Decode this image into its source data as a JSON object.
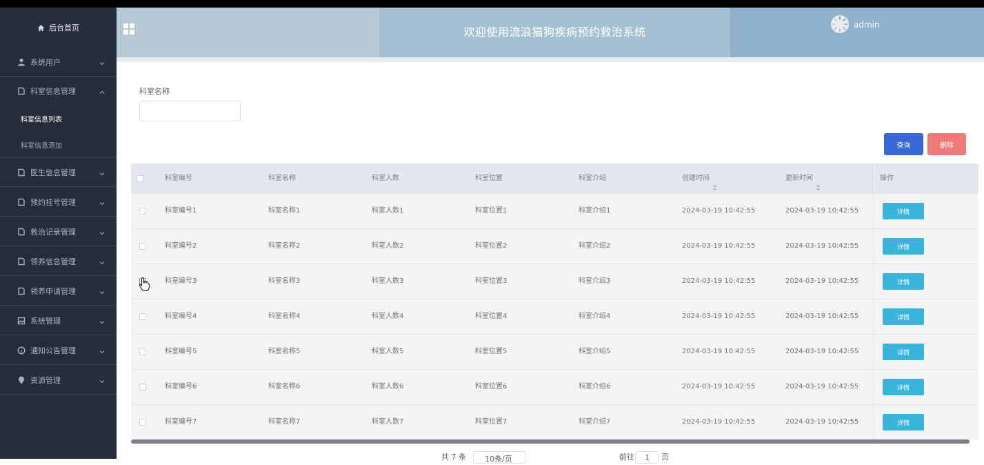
{
  "sidebar": {
    "home": "后台首页",
    "menu": [
      {
        "label": "系统用户",
        "icon": "user-icon",
        "expanded": false
      },
      {
        "label": "科室信息管理",
        "icon": "document-icon",
        "expanded": true,
        "children": [
          {
            "label": "科室信息列表",
            "active": true
          },
          {
            "label": "科室信息添加",
            "active": false
          }
        ]
      },
      {
        "label": "医生信息管理",
        "icon": "document-icon",
        "expanded": false
      },
      {
        "label": "预约挂号管理",
        "icon": "document-icon",
        "expanded": false
      },
      {
        "label": "救治记录管理",
        "icon": "document-icon",
        "expanded": false
      },
      {
        "label": "领养信息管理",
        "icon": "document-icon",
        "expanded": false
      },
      {
        "label": "领养申请管理",
        "icon": "document-icon",
        "expanded": false
      },
      {
        "label": "系统管理",
        "icon": "picture-icon",
        "expanded": false
      },
      {
        "label": "通知公告管理",
        "icon": "info-icon",
        "expanded": false
      },
      {
        "label": "资源管理",
        "icon": "location-icon",
        "expanded": false
      }
    ]
  },
  "header": {
    "title": "欢迎使用流浪猫狗疾病预约救治系统",
    "username": "admin",
    "colors": {
      "left": "#b7c9d6",
      "center": "#a6c0d3",
      "right": "#8fb1cb"
    }
  },
  "search": {
    "label": "科室名称",
    "value": "",
    "placeholder": ""
  },
  "actions": {
    "query": "查询",
    "delete": "删除"
  },
  "table": {
    "columns": [
      "科室编号",
      "科室名称",
      "科室人数",
      "科室位置",
      "科室介绍",
      "创建时间",
      "更新时间",
      "操作"
    ],
    "rows": [
      {
        "code": "科室编号1",
        "name": "科室名称1",
        "count": "科室人数1",
        "location": "科室位置1",
        "intro": "科室介绍1",
        "created": "2024-03-19 10:42:55",
        "updated": "2024-03-19 10:42:55",
        "action": "详情"
      },
      {
        "code": "科室编号2",
        "name": "科室名称2",
        "count": "科室人数2",
        "location": "科室位置2",
        "intro": "科室介绍2",
        "created": "2024-03-19 10:42:55",
        "updated": "2024-03-19 10:42:55",
        "action": "详情"
      },
      {
        "code": "科室编号3",
        "name": "科室名称3",
        "count": "科室人数3",
        "location": "科室位置3",
        "intro": "科室介绍3",
        "created": "2024-03-19 10:42:55",
        "updated": "2024-03-19 10:42:55",
        "action": "详情"
      },
      {
        "code": "科室编号4",
        "name": "科室名称4",
        "count": "科室人数4",
        "location": "科室位置4",
        "intro": "科室介绍4",
        "created": "2024-03-19 10:42:55",
        "updated": "2024-03-19 10:42:55",
        "action": "详情"
      },
      {
        "code": "科室编号5",
        "name": "科室名称5",
        "count": "科室人数5",
        "location": "科室位置5",
        "intro": "科室介绍5",
        "created": "2024-03-19 10:42:55",
        "updated": "2024-03-19 10:42:55",
        "action": "详情"
      },
      {
        "code": "科室编号6",
        "name": "科室名称6",
        "count": "科室人数6",
        "location": "科室位置6",
        "intro": "科室介绍6",
        "created": "2024-03-19 10:42:55",
        "updated": "2024-03-19 10:42:55",
        "action": "详情"
      },
      {
        "code": "科室编号7",
        "name": "科室名称7",
        "count": "科室人数7",
        "location": "科室位置7",
        "intro": "科室介绍7",
        "created": "2024-03-19 10:42:55",
        "updated": "2024-03-19 10:42:55",
        "action": "详情"
      }
    ]
  },
  "pager": {
    "total_prefix": "共 7 条",
    "page_size": "10条/页",
    "goto_prefix": "前往",
    "goto_value": "1",
    "goto_suffix": "页"
  }
}
